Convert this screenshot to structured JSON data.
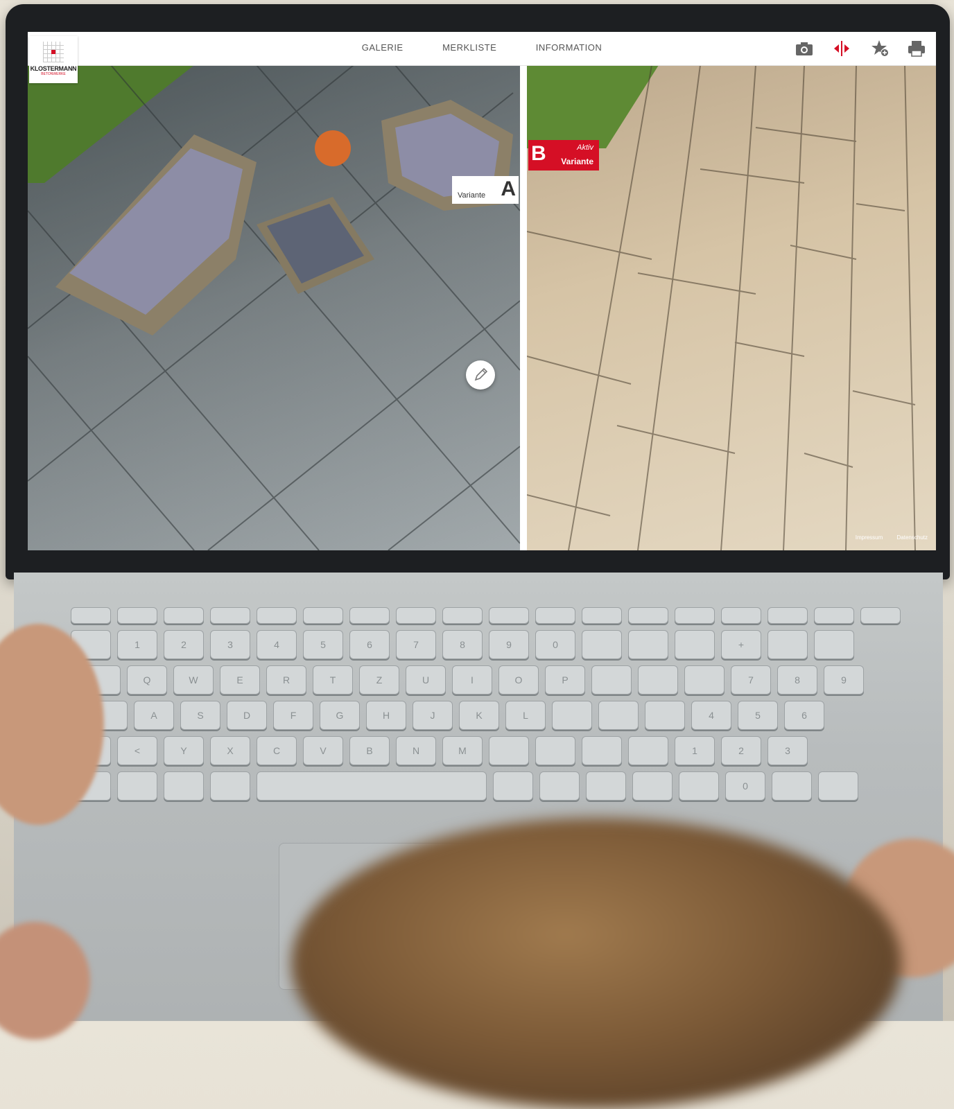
{
  "app": {
    "logo_text": "KLOSTERMANN",
    "logo_sub": "BETONWERKE"
  },
  "nav": {
    "items": [
      "GALERIE",
      "MERKLISTE",
      "INFORMATION"
    ]
  },
  "toolbar": {
    "icons": [
      "camera-icon",
      "compare-icon",
      "favorite-add-icon",
      "print-icon"
    ],
    "accent_color": "#d50f25"
  },
  "variants": {
    "a": {
      "letter": "A",
      "label": "Variante"
    },
    "b": {
      "letter": "B",
      "status": "Aktiv",
      "label": "Variante"
    }
  },
  "footer": {
    "links": [
      "Impressum",
      "Datenschutz"
    ]
  },
  "keyboard": {
    "rows": [
      [
        "",
        "",
        "",
        "",
        "",
        "",
        "",
        "",
        "",
        "",
        "",
        "",
        "",
        "",
        "",
        "",
        "",
        ""
      ],
      [
        "",
        "1",
        "2",
        "3",
        "4",
        "5",
        "6",
        "7",
        "8",
        "9",
        "0",
        "",
        "",
        "",
        "+",
        "",
        ""
      ],
      [
        "",
        "Q",
        "W",
        "E",
        "R",
        "T",
        "Z",
        "U",
        "I",
        "O",
        "P",
        "",
        "",
        "",
        "7",
        "8",
        "9"
      ],
      [
        "",
        "A",
        "S",
        "D",
        "F",
        "G",
        "H",
        "J",
        "K",
        "L",
        "",
        "",
        "",
        "4",
        "5",
        "6"
      ],
      [
        "",
        "<",
        "Y",
        "X",
        "C",
        "V",
        "B",
        "N",
        "M",
        "",
        "",
        "",
        "",
        "1",
        "2",
        "3"
      ],
      [
        "",
        "",
        "",
        "",
        "",
        "",
        "",
        "",
        "",
        "",
        "0",
        "",
        ""
      ]
    ]
  }
}
